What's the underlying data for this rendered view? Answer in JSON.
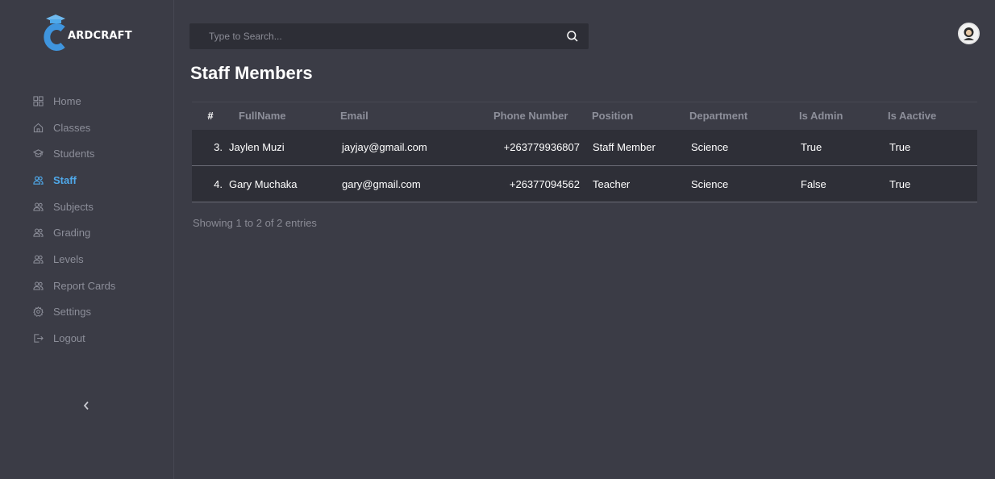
{
  "app": {
    "logo_text": "ARDCRAFT",
    "accent_color": "#4fa9ea"
  },
  "sidebar": {
    "items": [
      {
        "label": "Home",
        "icon": "grid-icon",
        "active": false
      },
      {
        "label": "Classes",
        "icon": "house-icon",
        "active": false
      },
      {
        "label": "Students",
        "icon": "graduation-cap-icon",
        "active": false
      },
      {
        "label": "Staff",
        "icon": "users-icon",
        "active": true
      },
      {
        "label": "Subjects",
        "icon": "users-icon",
        "active": false
      },
      {
        "label": "Grading",
        "icon": "users-icon",
        "active": false
      },
      {
        "label": "Levels",
        "icon": "users-icon",
        "active": false
      },
      {
        "label": "Report Cards",
        "icon": "users-icon",
        "active": false
      },
      {
        "label": "Settings",
        "icon": "gear-icon",
        "active": false
      },
      {
        "label": "Logout",
        "icon": "logout-icon",
        "active": false
      }
    ],
    "collapse_icon": "chevron-left-icon"
  },
  "header": {
    "search_placeholder": "Type to Search...",
    "search_value": ""
  },
  "main": {
    "title": "Staff Members",
    "table": {
      "columns": [
        "#",
        "FullName",
        "Email",
        "Phone Number",
        "Position",
        "Department",
        "Is Admin",
        "Is Aactive"
      ],
      "rows": [
        {
          "index": "3.",
          "fullname": "Jaylen Muzi",
          "email": "jayjay@gmail.com",
          "phone": "+263779936807",
          "position": "Staff Member",
          "department": "Science",
          "is_admin": "True",
          "is_active": "True"
        },
        {
          "index": "4.",
          "fullname": "Gary Muchaka",
          "email": "gary@gmail.com",
          "phone": "+26377094562",
          "position": "Teacher",
          "department": "Science",
          "is_admin": "False",
          "is_active": "True"
        }
      ]
    },
    "footer_info": "Showing 1 to 2 of 2 entries"
  }
}
